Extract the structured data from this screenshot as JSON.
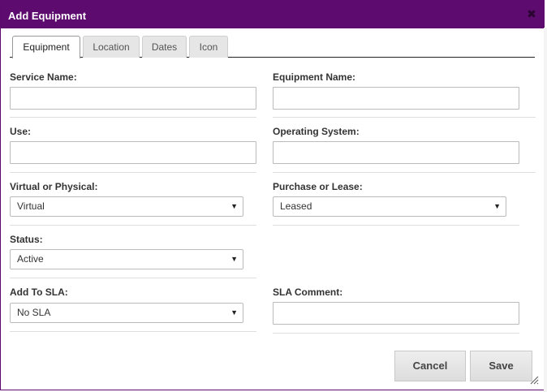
{
  "dialog": {
    "title": "Add Equipment",
    "close_glyph": "✖"
  },
  "tabs": [
    {
      "label": "Equipment",
      "active": true
    },
    {
      "label": "Location",
      "active": false
    },
    {
      "label": "Dates",
      "active": false
    },
    {
      "label": "Icon",
      "active": false
    }
  ],
  "fields": {
    "service_name": {
      "label": "Service Name:",
      "value": ""
    },
    "equipment_name": {
      "label": "Equipment Name:",
      "value": ""
    },
    "use": {
      "label": "Use:",
      "value": ""
    },
    "operating_system": {
      "label": "Operating System:",
      "value": ""
    },
    "virtual_or_physical": {
      "label": "Virtual or Physical:",
      "selected": "Virtual"
    },
    "purchase_or_lease": {
      "label": "Purchase or Lease:",
      "selected": "Leased"
    },
    "status": {
      "label": "Status:",
      "selected": "Active"
    },
    "add_to_sla": {
      "label": "Add To SLA:",
      "selected": "No SLA"
    },
    "sla_comment": {
      "label": "SLA Comment:",
      "value": ""
    }
  },
  "select_arrow": "▼",
  "buttons": {
    "cancel": "Cancel",
    "save": "Save"
  },
  "colors": {
    "titlebar": "#5e0b6f",
    "title_text": "#ffffff"
  }
}
